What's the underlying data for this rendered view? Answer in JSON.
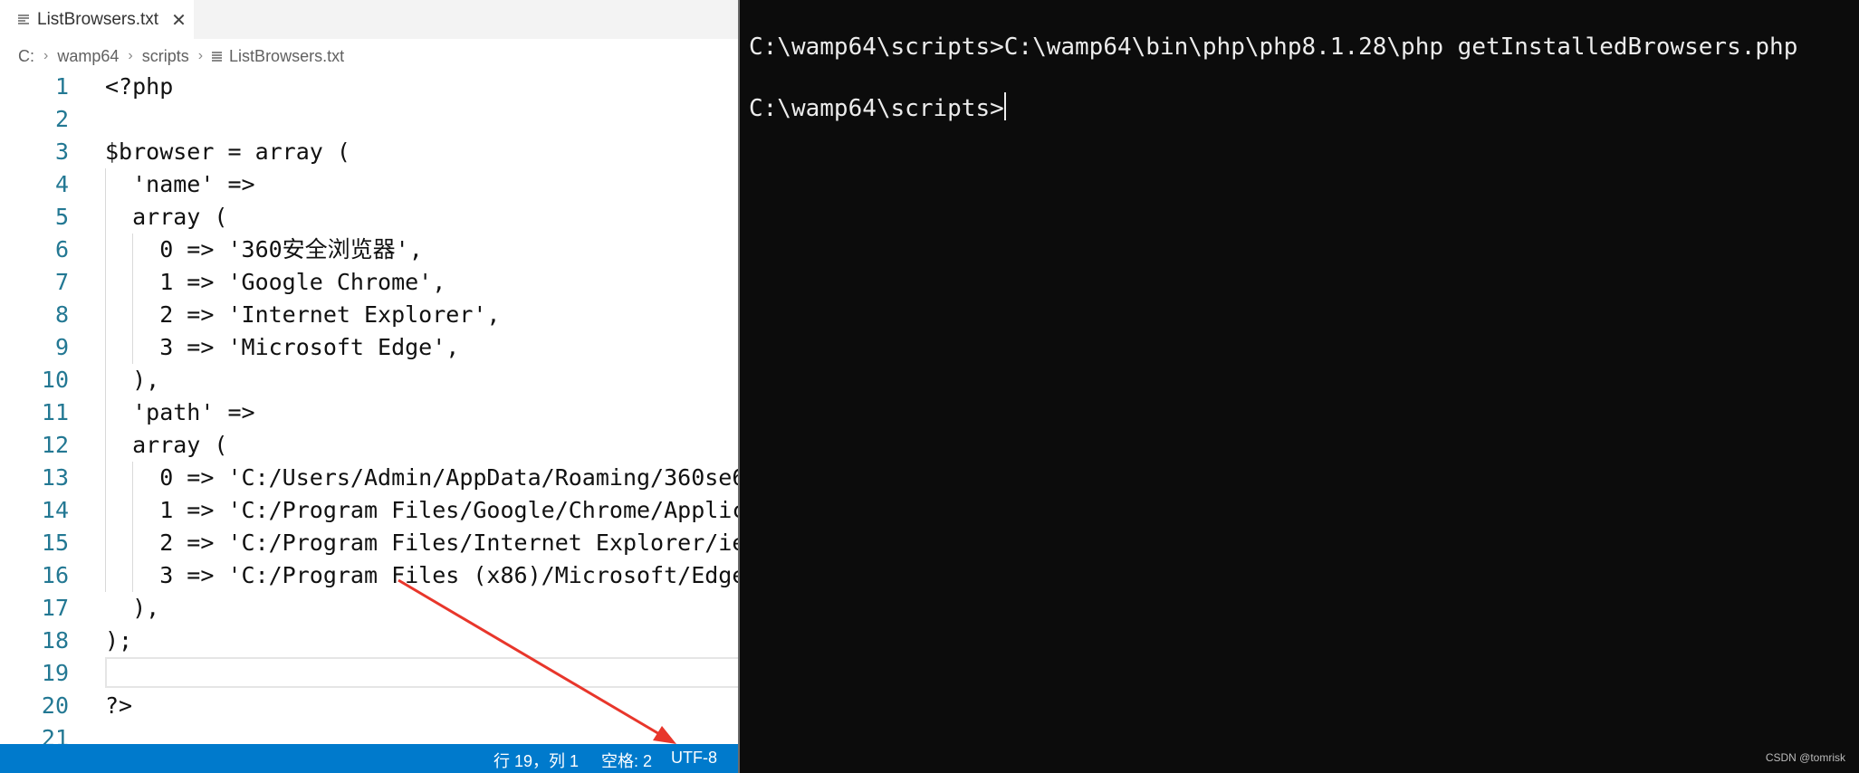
{
  "editor": {
    "tab_title": "ListBrowsers.txt",
    "close_glyph": "✕",
    "breadcrumb": [
      "C:",
      "wamp64",
      "scripts",
      "ListBrowsers.txt"
    ],
    "lines": [
      {
        "n": "1",
        "t": "<?php"
      },
      {
        "n": "2",
        "t": ""
      },
      {
        "n": "3",
        "t": "$browser = array ("
      },
      {
        "n": "4",
        "t": "  'name' =>"
      },
      {
        "n": "5",
        "t": "  array ("
      },
      {
        "n": "6",
        "t": "    0 => '360安全浏览器',"
      },
      {
        "n": "7",
        "t": "    1 => 'Google Chrome',"
      },
      {
        "n": "8",
        "t": "    2 => 'Internet Explorer',"
      },
      {
        "n": "9",
        "t": "    3 => 'Microsoft Edge',"
      },
      {
        "n": "10",
        "t": "  ),"
      },
      {
        "n": "11",
        "t": "  'path' =>"
      },
      {
        "n": "12",
        "t": "  array ("
      },
      {
        "n": "13",
        "t": "    0 => 'C:/Users/Admin/AppData/Roaming/360se6"
      },
      {
        "n": "14",
        "t": "    1 => 'C:/Program Files/Google/Chrome/Applic"
      },
      {
        "n": "15",
        "t": "    2 => 'C:/Program Files/Internet Explorer/ie"
      },
      {
        "n": "16",
        "t": "    3 => 'C:/Program Files (x86)/Microsoft/Edge"
      },
      {
        "n": "17",
        "t": "  ),"
      },
      {
        "n": "18",
        "t": ");"
      },
      {
        "n": "19",
        "t": ""
      },
      {
        "n": "20",
        "t": "?>"
      },
      {
        "n": "21",
        "t": ""
      }
    ],
    "current_line": "19"
  },
  "status": {
    "position": "行 19，列 1",
    "indent": "空格: 2",
    "encoding": "UTF-8"
  },
  "terminal": {
    "line1": "C:\\wamp64\\scripts>C:\\wamp64\\bin\\php\\php8.1.28\\php getInstalledBrowsers.php",
    "line2": "C:\\wamp64\\scripts>"
  },
  "watermark": "CSDN @tomrisk",
  "colors": {
    "statusbar": "#007acc",
    "terminal_bg": "#0c0c0c",
    "line_number": "#237893",
    "annotation_arrow": "#e8362b"
  }
}
